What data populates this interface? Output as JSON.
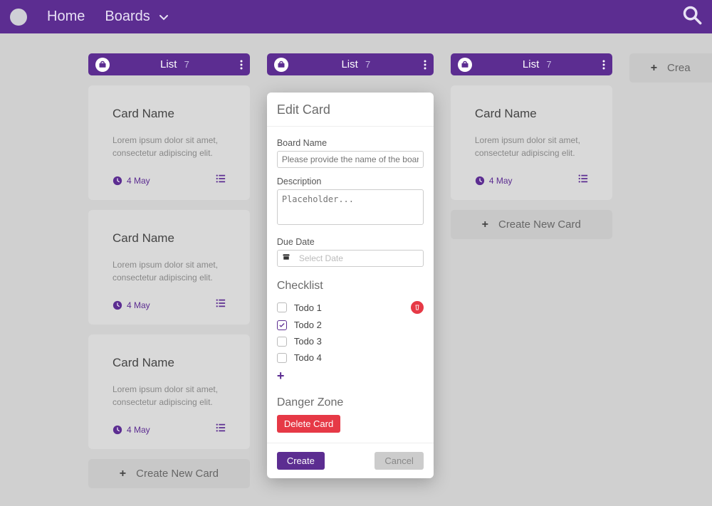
{
  "nav": {
    "home": "Home",
    "boards": "Boards"
  },
  "cols": [
    {
      "title": "List",
      "count": "7"
    },
    {
      "title": "List",
      "count": "7"
    },
    {
      "title": "List",
      "count": "7"
    }
  ],
  "card": {
    "title": "Card Name",
    "desc": "Lorem ipsum dolor sit amet, consectetur adipiscing elit.",
    "date": "4 May"
  },
  "newcard": "Create New Card",
  "newcard_cut": "Crea",
  "dialog": {
    "title": "Edit Card",
    "boardname_label": "Board Name",
    "boardname_ph": "Please provide the name of the board...",
    "desc_label": "Description",
    "desc_ph": "Placeholder...",
    "due_label": "Due Date",
    "due_ph": "Select Date",
    "checklist_title": "Checklist",
    "todos": [
      "Todo 1",
      "Todo 2",
      "Todo 3",
      "Todo 4"
    ],
    "danger_title": "Danger Zone",
    "delete_btn": "Delete Card",
    "create_btn": "Create",
    "cancel_btn": "Cancel"
  }
}
